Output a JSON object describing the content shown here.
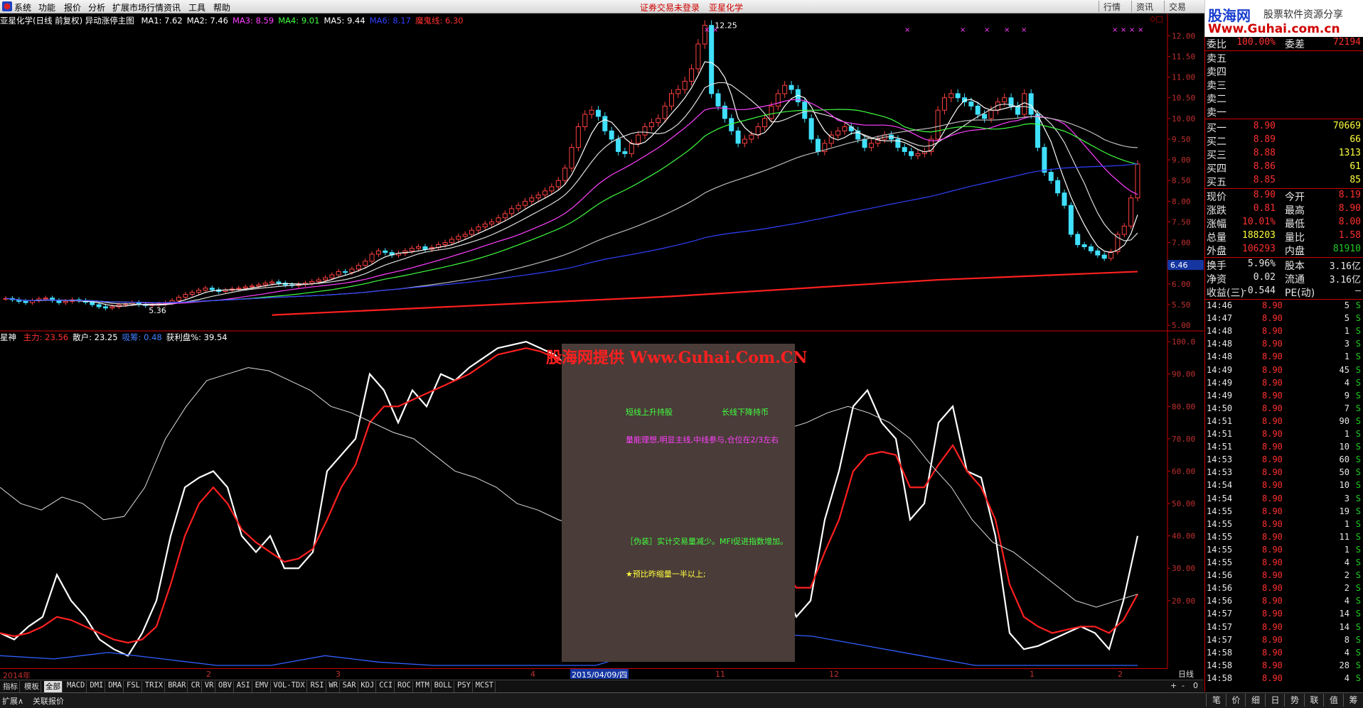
{
  "menu": {
    "items": [
      "系统",
      "功能",
      "报价",
      "分析",
      "扩展市场行情",
      "资讯",
      "工具",
      "帮助"
    ],
    "center_status": "证券交易未登录",
    "center_stock": "亚星化学",
    "right_buttons": [
      "行情",
      "资讯",
      "交易"
    ]
  },
  "logo": {
    "line1": "股海网",
    "line1b": "股票软件资源分享",
    "line2": "Www.Guhai.com.cn"
  },
  "main_legend": {
    "title": "亚星化学(日线 前复权) 异动涨停主图",
    "items": [
      {
        "text": "MA1: 7.62",
        "color": "#ffffff"
      },
      {
        "text": "MA2: 7.46",
        "color": "#ffffff"
      },
      {
        "text": "MA3: 8.59",
        "color": "#ff40ff"
      },
      {
        "text": "MA4: 9.01",
        "color": "#40ff40"
      },
      {
        "text": "MA5: 9.44",
        "color": "#ffffff"
      },
      {
        "text": "MA6: 8.17",
        "color": "#3040ff"
      },
      {
        "text": "魔鬼线: 6.30",
        "color": "#ff3030"
      }
    ]
  },
  "sub_legend": {
    "title": "星神",
    "items": [
      {
        "text": "主力: 23.56",
        "color": "#ff3030"
      },
      {
        "text": "散户: 23.25",
        "color": "#ffffff"
      },
      {
        "text": "吸筹: 0.48",
        "color": "#4080ff"
      },
      {
        "text": "获利盘%: 39.54",
        "color": "#ffffff"
      }
    ]
  },
  "chart_data": [
    {
      "type": "candlestick",
      "name": "main",
      "ylim": [
        4.9,
        12.4
      ],
      "yticks": [
        "12.00",
        "11.50",
        "11.00",
        "10.50",
        "10.00",
        "9.50",
        "9.00",
        "8.50",
        "8.00",
        "7.50",
        "7.00",
        "6.50",
        "6.00",
        "5.50",
        "5.00"
      ],
      "annotations": [
        {
          "text": "12.25",
          "value": 12.25
        },
        {
          "text": "5.36",
          "value": 5.36
        }
      ],
      "current_price_tag": "6.46",
      "closes": [
        5.65,
        5.62,
        5.58,
        5.55,
        5.6,
        5.64,
        5.66,
        5.6,
        5.55,
        5.58,
        5.62,
        5.6,
        5.56,
        5.5,
        5.45,
        5.42,
        5.45,
        5.5,
        5.52,
        5.55,
        5.5,
        5.48,
        5.5,
        5.52,
        5.55,
        5.6,
        5.68,
        5.75,
        5.8,
        5.85,
        5.9,
        5.86,
        5.82,
        5.85,
        5.88,
        5.9,
        5.93,
        5.95,
        5.98,
        6.02,
        6.05,
        6.02,
        5.98,
        5.96,
        5.99,
        6.02,
        6.06,
        6.1,
        6.15,
        6.22,
        6.3,
        6.28,
        6.36,
        6.45,
        6.55,
        6.72,
        6.8,
        6.76,
        6.7,
        6.74,
        6.8,
        6.86,
        6.9,
        6.84,
        6.88,
        6.95,
        7.0,
        7.08,
        7.15,
        7.2,
        7.3,
        7.38,
        7.45,
        7.5,
        7.6,
        7.7,
        7.82,
        7.9,
        8.0,
        8.08,
        8.15,
        8.25,
        8.35,
        8.5,
        8.8,
        9.3,
        9.8,
        10.1,
        10.2,
        10.05,
        9.7,
        9.5,
        9.2,
        9.15,
        9.4,
        9.6,
        9.8,
        9.9,
        10.0,
        10.3,
        10.6,
        10.7,
        10.9,
        11.2,
        11.8,
        12.25,
        10.6,
        10.3,
        10.0,
        9.7,
        9.4,
        9.5,
        9.6,
        9.8,
        10.0,
        10.3,
        10.6,
        10.8,
        10.7,
        10.4,
        10.0,
        9.5,
        9.2,
        9.4,
        9.6,
        9.7,
        9.8,
        9.7,
        9.5,
        9.3,
        9.4,
        9.5,
        9.6,
        9.5,
        9.3,
        9.2,
        9.1,
        9.15,
        9.2,
        9.5,
        10.2,
        10.5,
        10.6,
        10.5,
        10.4,
        10.3,
        10.1,
        10.0,
        10.2,
        10.4,
        10.5,
        10.3,
        10.1,
        10.6,
        10.1,
        9.3,
        8.7,
        8.5,
        8.2,
        7.9,
        7.2,
        6.95,
        6.9,
        6.8,
        6.7,
        6.62,
        6.78,
        7.2,
        7.4,
        8.08,
        8.9
      ]
    },
    {
      "type": "line",
      "name": "xingshen",
      "ylim": [
        0,
        102
      ],
      "yticks": [
        "100.0",
        "90.00",
        "80.00",
        "70.00",
        "60.00",
        "50.00",
        "40.00",
        "30.00",
        "20.00"
      ],
      "series": [
        {
          "name": "散户",
          "values": [
            10,
            8,
            12,
            15,
            28,
            20,
            15,
            8,
            5,
            3,
            10,
            20,
            40,
            55,
            58,
            60,
            55,
            40,
            35,
            40,
            30,
            30,
            35,
            60,
            65,
            70,
            90,
            85,
            75,
            85,
            80,
            90,
            88,
            92,
            95,
            98,
            99,
            100,
            98,
            96,
            92,
            94,
            97,
            99,
            98,
            95,
            60,
            55,
            40,
            35,
            25,
            25,
            30,
            35,
            38,
            25,
            15,
            20,
            45,
            60,
            80,
            85,
            75,
            70,
            45,
            50,
            75,
            80,
            60,
            58,
            40,
            10,
            5,
            6,
            8,
            10,
            12,
            10,
            5,
            20,
            40
          ]
        },
        {
          "name": "主力",
          "values": [
            10,
            9,
            10,
            12,
            15,
            14,
            12,
            10,
            8,
            7,
            8,
            12,
            25,
            40,
            50,
            55,
            50,
            42,
            38,
            35,
            32,
            33,
            36,
            45,
            55,
            62,
            75,
            80,
            80,
            82,
            84,
            86,
            88,
            90,
            93,
            96,
            97,
            98,
            97,
            95,
            93,
            92,
            94,
            96,
            97,
            95,
            70,
            62,
            52,
            45,
            38,
            32,
            30,
            32,
            35,
            30,
            24,
            24,
            35,
            45,
            60,
            65,
            66,
            65,
            55,
            55,
            62,
            68,
            60,
            55,
            45,
            25,
            15,
            12,
            10,
            11,
            12,
            12,
            10,
            14,
            22
          ]
        },
        {
          "name": "获利盘",
          "values": [
            55,
            50,
            48,
            52,
            50,
            45,
            46,
            55,
            70,
            80,
            88,
            90,
            92,
            91,
            88,
            85,
            80,
            78,
            75,
            72,
            70,
            65,
            60,
            58,
            55,
            50,
            48,
            45,
            43,
            42,
            45,
            48,
            52,
            55,
            58,
            62,
            65,
            70,
            73,
            75,
            78,
            80,
            78,
            75,
            70,
            62,
            55,
            45,
            38,
            35,
            30,
            25,
            20,
            18,
            20,
            22
          ]
        },
        {
          "name": "吸筹",
          "values": [
            3,
            2,
            4,
            2,
            0,
            0,
            3,
            1,
            0,
            0,
            0,
            0,
            5,
            8,
            10,
            9,
            6,
            3,
            0,
            0,
            0,
            0
          ]
        }
      ]
    }
  ],
  "overlay": {
    "line1a": "短线上升持股",
    "line1b": "长线下降持币",
    "line2": "量能理想,明显主线,中线参与,仓位在2/3左右",
    "line3": "［伪装］实计交易量减少。MFI促进指数增加。",
    "line4": "★预比昨缩量一半以上;"
  },
  "watermark": "股海网提供 Www.Guhai.Com.CN",
  "xaxis": {
    "labels": [
      "2014年",
      "2",
      "3",
      "4",
      "11",
      "12",
      "1",
      "2"
    ],
    "selected": "2015/04/09/四",
    "period": "日线"
  },
  "indicator_tabs": [
    "指标",
    "模板",
    "全部",
    "MACD",
    "DMI",
    "DMA",
    "FSL",
    "TRIX",
    "BRAR",
    "CR",
    "VR",
    "OBV",
    "ASI",
    "EMV",
    "VOL-TDX",
    "RSI",
    "WR",
    "SAR",
    "KDJ",
    "CCI",
    "ROC",
    "MTM",
    "BOLL",
    "PSY",
    "MCST"
  ],
  "bottom": {
    "left": [
      "扩展∧",
      "关联报价"
    ],
    "right_tabs": [
      "笔",
      "价",
      "细",
      "日",
      "势",
      "联",
      "值",
      "筹"
    ],
    "pm": [
      "+",
      "-",
      "0"
    ]
  },
  "quote": {
    "header": {
      "k1": "委比",
      "v1": "100.00%",
      "k2": "委差",
      "v2": "72194"
    },
    "sells": [
      {
        "k": "卖五"
      },
      {
        "k": "卖四"
      },
      {
        "k": "卖三"
      },
      {
        "k": "卖二"
      },
      {
        "k": "卖一"
      }
    ],
    "buys": [
      {
        "k": "买一",
        "p": "8.90",
        "v": "70669"
      },
      {
        "k": "买二",
        "p": "8.89",
        "v": "66"
      },
      {
        "k": "买三",
        "p": "8.88",
        "v": "1313"
      },
      {
        "k": "买四",
        "p": "8.86",
        "v": "61"
      },
      {
        "k": "买五",
        "p": "8.85",
        "v": "85"
      }
    ],
    "stats": [
      {
        "k1": "现价",
        "v1": "8.90",
        "c1": "#ff3030",
        "k2": "今开",
        "v2": "8.19",
        "c2": "#ff3030"
      },
      {
        "k1": "涨跌",
        "v1": "0.81",
        "c1": "#ff3030",
        "k2": "最高",
        "v2": "8.90",
        "c2": "#ff3030"
      },
      {
        "k1": "涨幅",
        "v1": "10.01%",
        "c1": "#ff3030",
        "k2": "最低",
        "v2": "8.00",
        "c2": "#ff3030"
      },
      {
        "k1": "总量",
        "v1": "188203",
        "c1": "#ffff40",
        "k2": "量比",
        "v2": "1.58",
        "c2": "#ff3030"
      },
      {
        "k1": "外盘",
        "v1": "106293",
        "c1": "#ff3030",
        "k2": "内盘",
        "v2": "81910",
        "c2": "#22cc22"
      }
    ],
    "stats2": [
      {
        "k1": "换手",
        "v1": "5.96%",
        "k2": "股本",
        "v2": "3.16亿"
      },
      {
        "k1": "净资",
        "v1": "0.02",
        "k2": "流通",
        "v2": "3.16亿"
      },
      {
        "k1": "收益(三)",
        "v1": "-0.544",
        "k2": "PE(动)",
        "v2": "–"
      }
    ],
    "ticks": [
      {
        "t": "14:46",
        "p": "8.90",
        "v": "5",
        "s": "S"
      },
      {
        "t": "14:47",
        "p": "8.90",
        "v": "5",
        "s": "S"
      },
      {
        "t": "14:48",
        "p": "8.90",
        "v": "1",
        "s": "S"
      },
      {
        "t": "14:48",
        "p": "8.90",
        "v": "3",
        "s": "S"
      },
      {
        "t": "14:48",
        "p": "8.90",
        "v": "1",
        "s": "S"
      },
      {
        "t": "14:49",
        "p": "8.90",
        "v": "45",
        "s": "S"
      },
      {
        "t": "14:49",
        "p": "8.90",
        "v": "4",
        "s": "S"
      },
      {
        "t": "14:49",
        "p": "8.90",
        "v": "9",
        "s": "S"
      },
      {
        "t": "14:50",
        "p": "8.90",
        "v": "7",
        "s": "S"
      },
      {
        "t": "14:51",
        "p": "8.90",
        "v": "90",
        "s": "S"
      },
      {
        "t": "14:51",
        "p": "8.90",
        "v": "1",
        "s": "S"
      },
      {
        "t": "14:51",
        "p": "8.90",
        "v": "10",
        "s": "S"
      },
      {
        "t": "14:53",
        "p": "8.90",
        "v": "60",
        "s": "S"
      },
      {
        "t": "14:53",
        "p": "8.90",
        "v": "50",
        "s": "S"
      },
      {
        "t": "14:54",
        "p": "8.90",
        "v": "10",
        "s": "S"
      },
      {
        "t": "14:54",
        "p": "8.90",
        "v": "3",
        "s": "S"
      },
      {
        "t": "14:55",
        "p": "8.90",
        "v": "19",
        "s": "S"
      },
      {
        "t": "14:55",
        "p": "8.90",
        "v": "1",
        "s": "S"
      },
      {
        "t": "14:55",
        "p": "8.90",
        "v": "11",
        "s": "S"
      },
      {
        "t": "14:55",
        "p": "8.90",
        "v": "1",
        "s": "S"
      },
      {
        "t": "14:55",
        "p": "8.90",
        "v": "4",
        "s": "S"
      },
      {
        "t": "14:56",
        "p": "8.90",
        "v": "2",
        "s": "S"
      },
      {
        "t": "14:56",
        "p": "8.90",
        "v": "2",
        "s": "S"
      },
      {
        "t": "14:56",
        "p": "8.90",
        "v": "4",
        "s": "S"
      },
      {
        "t": "14:57",
        "p": "8.90",
        "v": "14",
        "s": "S"
      },
      {
        "t": "14:57",
        "p": "8.90",
        "v": "14",
        "s": "S"
      },
      {
        "t": "14:57",
        "p": "8.90",
        "v": "8",
        "s": "S"
      },
      {
        "t": "14:58",
        "p": "8.90",
        "v": "4",
        "s": "S"
      },
      {
        "t": "14:58",
        "p": "8.90",
        "v": "28",
        "s": "S"
      },
      {
        "t": "14:58",
        "p": "8.90",
        "v": "4",
        "s": "S"
      }
    ]
  }
}
